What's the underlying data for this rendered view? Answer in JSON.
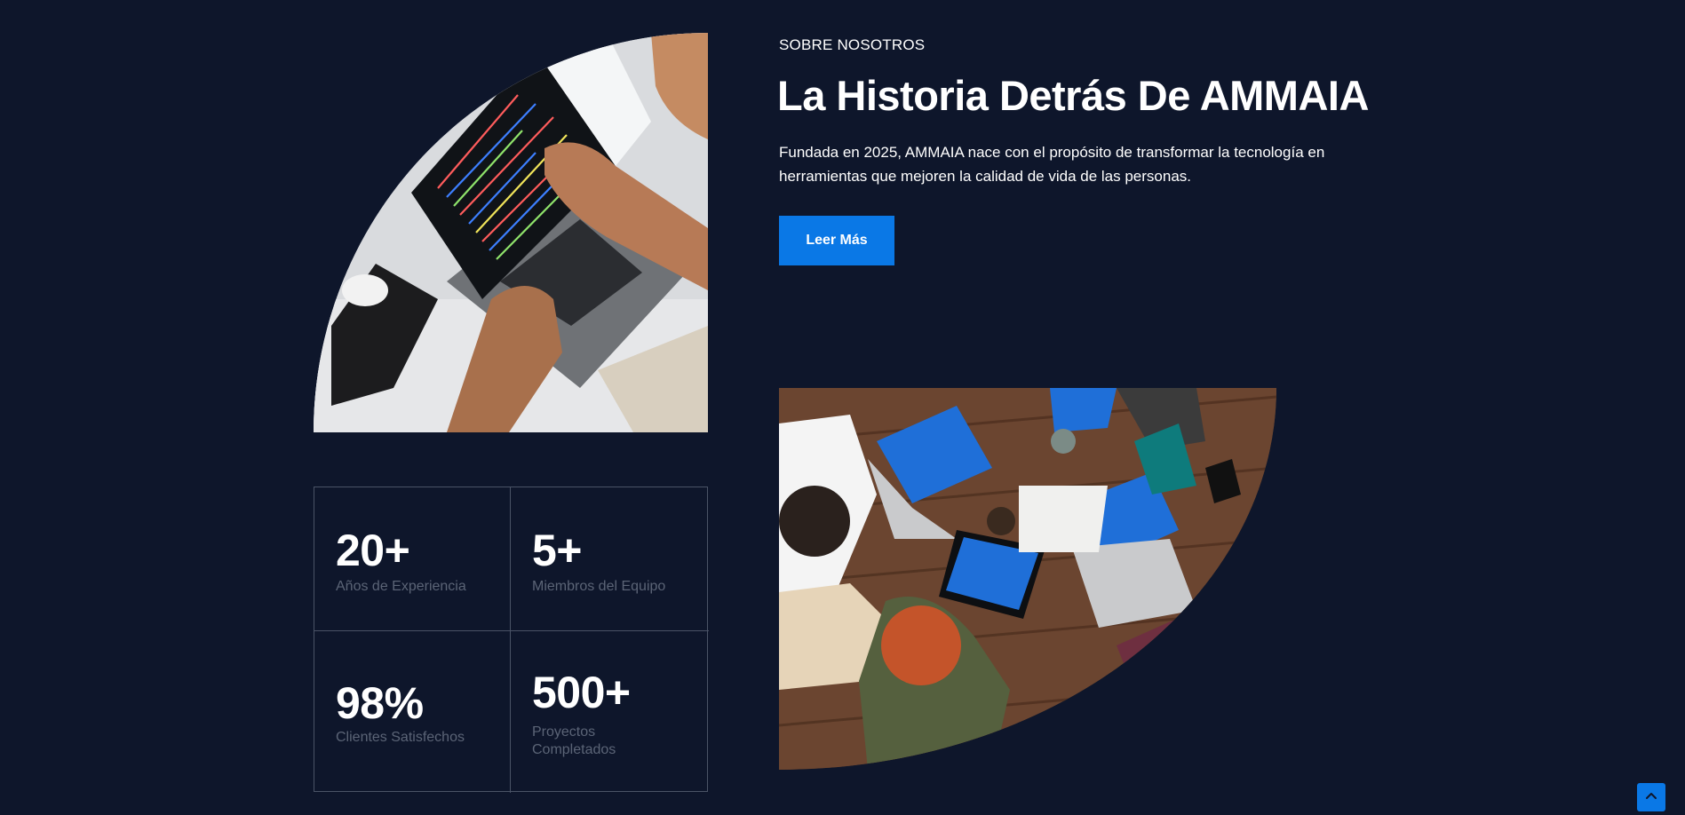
{
  "about": {
    "eyebrow": "SOBRE NOSOTROS",
    "headline": "La Historia Detrás De AMMAIA",
    "description": "Fundada en 2025, AMMAIA nace con el propósito de transformar la tecnología en herramientas que mejoren la calidad de vida de las personas.",
    "cta_label": "Leer Más"
  },
  "stats": [
    {
      "value": "20+",
      "label": "Años de Experiencia"
    },
    {
      "value": "5+",
      "label": "Miembros del Equipo"
    },
    {
      "value": "98%",
      "label": "Clientes Satisfechos"
    },
    {
      "value": "500+",
      "label": "Proyectos Completados"
    }
  ],
  "images": {
    "top": "laptop-coding-photo",
    "bottom": "team-meeting-table-photo"
  },
  "icons": {
    "scroll_top": "chevron-up-icon"
  },
  "colors": {
    "background": "#0e162b",
    "accent": "#0a78e6",
    "muted_text": "#5b6476",
    "grid_border": "#4a5366"
  }
}
